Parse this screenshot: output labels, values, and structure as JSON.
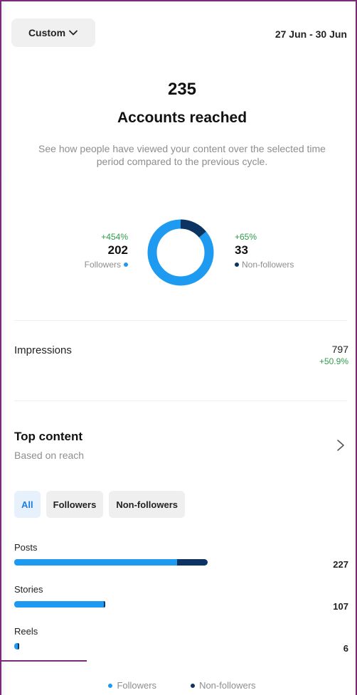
{
  "header": {
    "period_button": "Custom",
    "date_range": "27 Jun - 30 Jun"
  },
  "reach": {
    "value": "235",
    "label": "Accounts reached",
    "description": "See how people have viewed your content over the selected time period compared to the previous cycle."
  },
  "followers": {
    "change": "+454%",
    "count": "202",
    "label": "Followers",
    "count_value": 202
  },
  "non_followers": {
    "change": "+65%",
    "count": "33",
    "label": "Non-followers",
    "count_value": 33
  },
  "impressions": {
    "label": "Impressions",
    "value": "797",
    "change": "+50.9%"
  },
  "top_content": {
    "title": "Top content",
    "subtitle": "Based on reach",
    "filters": [
      {
        "label": "All",
        "active": true
      },
      {
        "label": "Followers",
        "active": false
      },
      {
        "label": "Non-followers",
        "active": false
      }
    ]
  },
  "chart_data": {
    "type": "bar",
    "categories": [
      "Posts",
      "Stories",
      "Reels"
    ],
    "totals": [
      227,
      107,
      6
    ],
    "series": [
      {
        "name": "Followers",
        "values": [
          191,
          105,
          4
        ]
      },
      {
        "name": "Non-followers",
        "values": [
          36,
          2,
          2
        ]
      }
    ],
    "legend": [
      "Followers",
      "Non-followers"
    ]
  },
  "colors": {
    "followers": "#1e9bf0",
    "non_followers": "#0b3463",
    "positive": "#2e9d4a"
  }
}
